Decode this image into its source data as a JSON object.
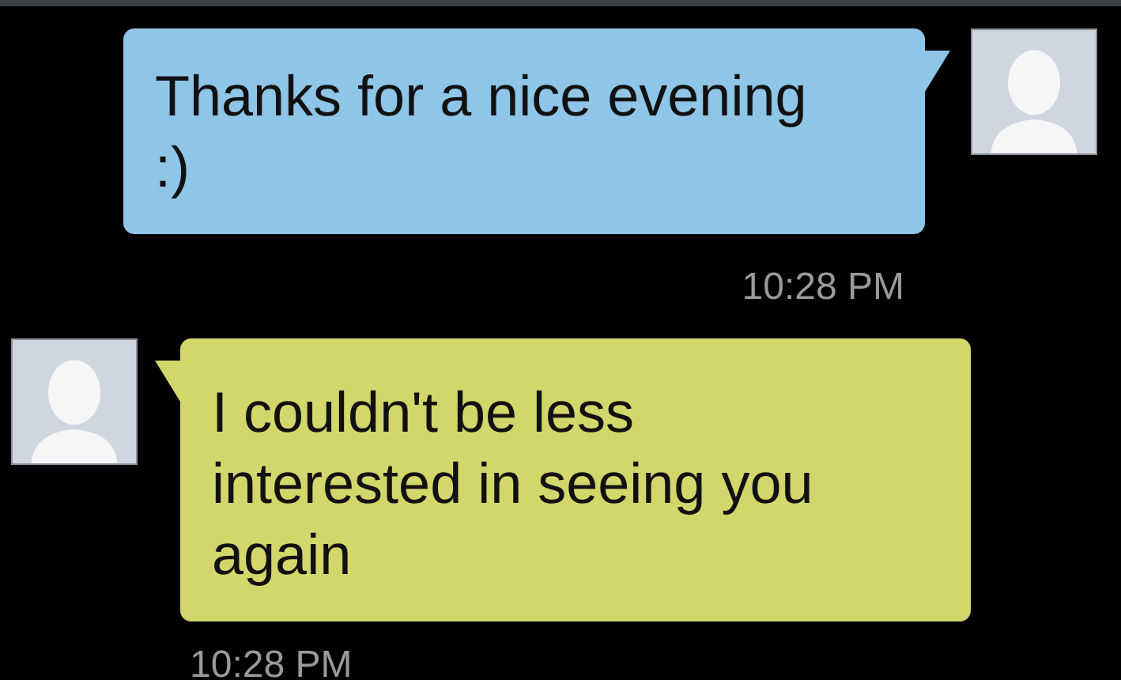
{
  "messages": [
    {
      "kind": "outgoing",
      "text": "Thanks for a nice evening :)",
      "time": "10:28 PM"
    },
    {
      "kind": "incoming",
      "text": "I couldn't be less interested in seeing you again",
      "time": "10:28 PM"
    }
  ]
}
